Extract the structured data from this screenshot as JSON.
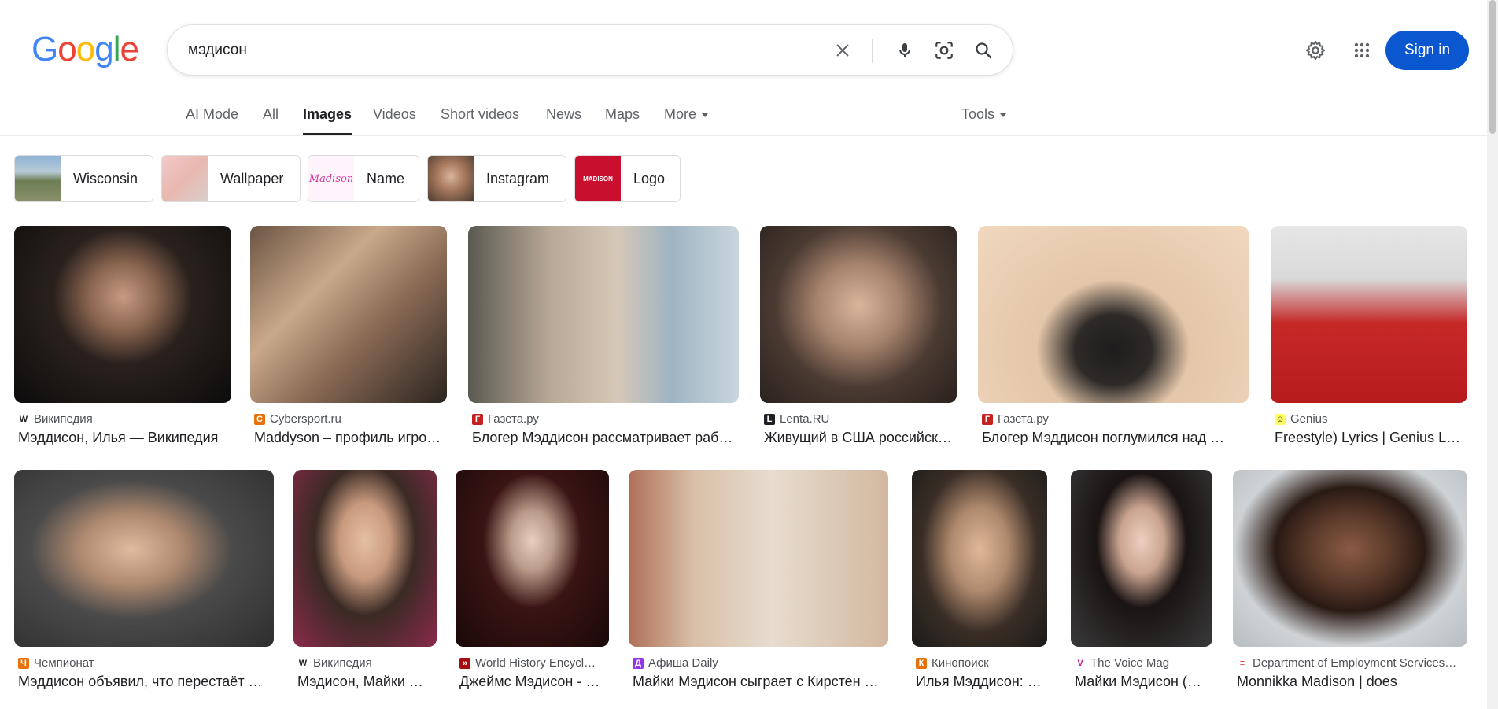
{
  "logo": {
    "letters": [
      "G",
      "o",
      "o",
      "g",
      "l",
      "e"
    ],
    "colors": [
      "#4285F4",
      "#EA4335",
      "#FBBC05",
      "#4285F4",
      "#34A853",
      "#EA4335"
    ]
  },
  "search": {
    "query": "мэдисон"
  },
  "header": {
    "sign_in": "Sign in"
  },
  "tabs": [
    {
      "label": "AI Mode"
    },
    {
      "label": "All"
    },
    {
      "label": "Images",
      "active": true
    },
    {
      "label": "Videos"
    },
    {
      "label": "Short videos"
    },
    {
      "label": "News"
    },
    {
      "label": "Maps"
    },
    {
      "label": "More"
    }
  ],
  "tools": "Tools",
  "chips": [
    {
      "label": "Wisconsin"
    },
    {
      "label": "Wallpaper"
    },
    {
      "label": "Name"
    },
    {
      "label": "Instagram"
    },
    {
      "label": "Logo"
    }
  ],
  "row1": [
    {
      "source": "Википедия",
      "title": "Мэддисон, Илья — Википедия",
      "favicon": "W",
      "fav_color": "#202124"
    },
    {
      "source": "Cybersport.ru",
      "title": "Maddyson – профиль игро…",
      "favicon": "C",
      "fav_color": "#e8710a"
    },
    {
      "source": "Газета.ру",
      "title": "Блогер Мэддисон рассматривает раб…",
      "favicon": "Г",
      "fav_color": "#c5221f"
    },
    {
      "source": "Lenta.RU",
      "title": "Живущий в США российск…",
      "favicon": "L",
      "fav_color": "#202124"
    },
    {
      "source": "Газета.ру",
      "title": "Блогер Мэддисон поглумился над …",
      "favicon": "Г",
      "fav_color": "#c5221f"
    },
    {
      "source": "Genius",
      "title": "Freestyle) Lyrics | Genius L…",
      "favicon": "☺",
      "fav_color": "#ffff64"
    }
  ],
  "row2": [
    {
      "source": "Чемпионат",
      "title": "Мэддисон объявил, что перестаёт …",
      "favicon": "Ч",
      "fav_color": "#e8710a"
    },
    {
      "source": "Википедия",
      "title": "Мэдисон, Майки …",
      "favicon": "W",
      "fav_color": "#202124"
    },
    {
      "source": "World History Encycl…",
      "title": "Джеймс Мэдисон - …",
      "favicon": "»",
      "fav_color": "#a50e0e"
    },
    {
      "source": "Афиша Daily",
      "title": "Майки Мэдисон сыграет с Кирстен …",
      "favicon": "Д",
      "fav_color": "#9334e6"
    },
    {
      "source": "Кинопоиск",
      "title": "Илья Мэддисон: …",
      "favicon": "К",
      "fav_color": "#e8710a"
    },
    {
      "source": "The Voice Mag",
      "title": "Майки Мэдисон (…",
      "favicon": "V",
      "fav_color": "#d01884"
    },
    {
      "source": "Department of Employment Services…",
      "title": "Monnikka Madison | does",
      "favicon": "≡",
      "fav_color": "#d93025"
    }
  ]
}
